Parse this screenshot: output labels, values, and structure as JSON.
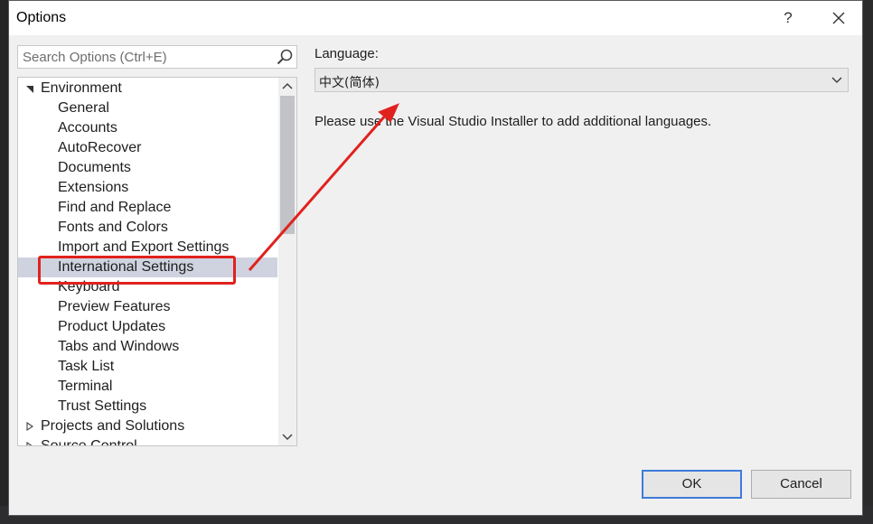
{
  "dialog": {
    "title": "Options",
    "help_symbol": "?",
    "close_symbol": "✕"
  },
  "search": {
    "placeholder": "Search Options (Ctrl+E)",
    "icon": "search-icon"
  },
  "tree": {
    "nodes": [
      {
        "label": "Environment",
        "expanded": true
      },
      {
        "label": "General"
      },
      {
        "label": "Accounts"
      },
      {
        "label": "AutoRecover"
      },
      {
        "label": "Documents"
      },
      {
        "label": "Extensions"
      },
      {
        "label": "Find and Replace"
      },
      {
        "label": "Fonts and Colors"
      },
      {
        "label": "Import and Export Settings"
      },
      {
        "label": "International Settings",
        "selected": true
      },
      {
        "label": "Keyboard"
      },
      {
        "label": "Preview Features"
      },
      {
        "label": "Product Updates"
      },
      {
        "label": "Tabs and Windows"
      },
      {
        "label": "Task List"
      },
      {
        "label": "Terminal"
      },
      {
        "label": "Trust Settings"
      },
      {
        "label": "Projects and Solutions",
        "expanded": false
      },
      {
        "label": "Source Control",
        "expanded": false
      }
    ]
  },
  "language": {
    "label": "Language:",
    "selected": "中文(简体)",
    "info": "Please use the Visual Studio Installer to add additional languages."
  },
  "buttons": {
    "ok": "OK",
    "cancel": "Cancel"
  },
  "annotation": {
    "color": "#e0221e"
  }
}
